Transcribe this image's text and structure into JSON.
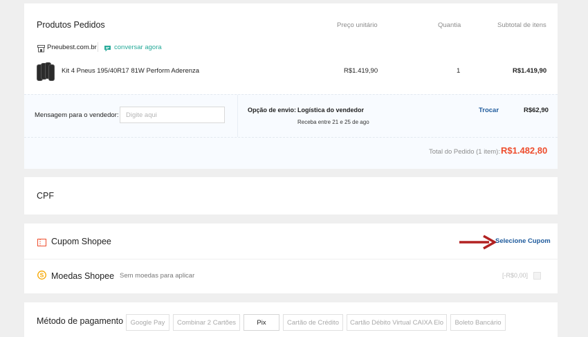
{
  "order": {
    "title": "Produtos Pedidos",
    "col_price": "Preço unitário",
    "col_qty": "Quantia",
    "col_subtotal": "Subtotal de itens",
    "shop_name": "Pneubest.com.br",
    "chat_label": "conversar agora",
    "product_name": "Kit 4 Pneus 195/40R17 81W Perform Aderenza",
    "unit_price": "R$1.419,90",
    "quantity": "1",
    "subtotal": "R$1.419,90"
  },
  "seller_message": {
    "label": "Mensagem para o vendedor:",
    "placeholder": "Digite aqui",
    "value": ""
  },
  "shipping": {
    "label": "Opção de envio:",
    "method": "Logística do vendedor",
    "eta": "Receba entre 21 e 25 de ago",
    "change_label": "Trocar",
    "price": "R$62,90"
  },
  "order_total": {
    "label": "Total do Pedido (1 item):",
    "value": "R$1.482,80"
  },
  "cpf": {
    "title": "CPF"
  },
  "coupon": {
    "title": "Cupom Shopee",
    "action": "Selecione Cupom"
  },
  "coins": {
    "title": "Moedas Shopee",
    "note": "Sem moedas para aplicar",
    "value": "[-R$0,00]",
    "checked": false
  },
  "payment": {
    "title": "Método de pagamento",
    "options": [
      "Google Pay",
      "Combinar 2 Cartões",
      "Pix",
      "Cartão de Crédito",
      "Cartão Débito Virtual CAIXA Elo",
      "Boleto Bancário"
    ],
    "selected": "Pix"
  },
  "colors": {
    "accent": "#ee4d2d",
    "link": "#1e5a9c",
    "chat": "#26aa99",
    "arrow": "#b22222",
    "coin": "#f6a700"
  }
}
